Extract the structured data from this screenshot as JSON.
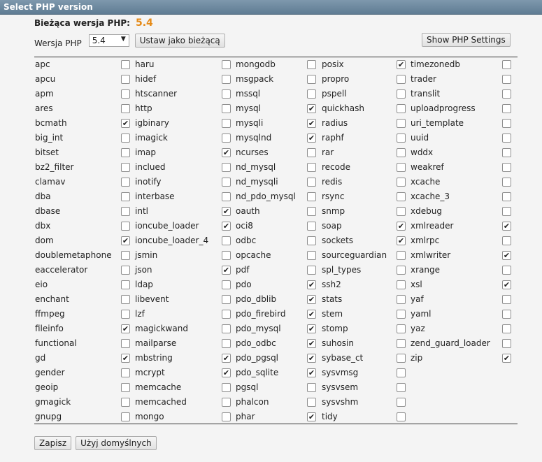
{
  "window": {
    "title": "Select PHP version"
  },
  "current": {
    "label": "Bieżąca wersja PHP:",
    "value": "5.4"
  },
  "version": {
    "label": "Wersja PHP",
    "selected": "5.4",
    "set_button": "Ustaw jako bieżącą",
    "settings_button": "Show PHP Settings"
  },
  "columns": [
    [
      {
        "name": "apc",
        "checked": false
      },
      {
        "name": "apcu",
        "checked": false
      },
      {
        "name": "apm",
        "checked": false
      },
      {
        "name": "ares",
        "checked": false
      },
      {
        "name": "bcmath",
        "checked": true
      },
      {
        "name": "big_int",
        "checked": false
      },
      {
        "name": "bitset",
        "checked": false
      },
      {
        "name": "bz2_filter",
        "checked": false
      },
      {
        "name": "clamav",
        "checked": false
      },
      {
        "name": "dba",
        "checked": false
      },
      {
        "name": "dbase",
        "checked": false
      },
      {
        "name": "dbx",
        "checked": false
      },
      {
        "name": "dom",
        "checked": true
      },
      {
        "name": "doublemetaphone",
        "checked": false
      },
      {
        "name": "eaccelerator",
        "checked": false
      },
      {
        "name": "eio",
        "checked": false
      },
      {
        "name": "enchant",
        "checked": false
      },
      {
        "name": "ffmpeg",
        "checked": false
      },
      {
        "name": "fileinfo",
        "checked": true
      },
      {
        "name": "functional",
        "checked": false
      },
      {
        "name": "gd",
        "checked": true
      },
      {
        "name": "gender",
        "checked": false
      },
      {
        "name": "geoip",
        "checked": false
      },
      {
        "name": "gmagick",
        "checked": false
      },
      {
        "name": "gnupg",
        "checked": false
      }
    ],
    [
      {
        "name": "haru",
        "checked": false
      },
      {
        "name": "hidef",
        "checked": false
      },
      {
        "name": "htscanner",
        "checked": false
      },
      {
        "name": "http",
        "checked": false
      },
      {
        "name": "igbinary",
        "checked": false
      },
      {
        "name": "imagick",
        "checked": false
      },
      {
        "name": "imap",
        "checked": true
      },
      {
        "name": "inclued",
        "checked": false
      },
      {
        "name": "inotify",
        "checked": false
      },
      {
        "name": "interbase",
        "checked": false
      },
      {
        "name": "intl",
        "checked": true
      },
      {
        "name": "ioncube_loader",
        "checked": true
      },
      {
        "name": "ioncube_loader_4",
        "checked": false
      },
      {
        "name": "jsmin",
        "checked": false
      },
      {
        "name": "json",
        "checked": true
      },
      {
        "name": "ldap",
        "checked": false
      },
      {
        "name": "libevent",
        "checked": false
      },
      {
        "name": "lzf",
        "checked": false
      },
      {
        "name": "magickwand",
        "checked": false
      },
      {
        "name": "mailparse",
        "checked": false
      },
      {
        "name": "mbstring",
        "checked": true
      },
      {
        "name": "mcrypt",
        "checked": true
      },
      {
        "name": "memcache",
        "checked": false
      },
      {
        "name": "memcached",
        "checked": false
      },
      {
        "name": "mongo",
        "checked": false
      }
    ],
    [
      {
        "name": "mongodb",
        "checked": false
      },
      {
        "name": "msgpack",
        "checked": false
      },
      {
        "name": "mssql",
        "checked": false
      },
      {
        "name": "mysql",
        "checked": true
      },
      {
        "name": "mysqli",
        "checked": true
      },
      {
        "name": "mysqlnd",
        "checked": true
      },
      {
        "name": "ncurses",
        "checked": false
      },
      {
        "name": "nd_mysql",
        "checked": false
      },
      {
        "name": "nd_mysqli",
        "checked": false
      },
      {
        "name": "nd_pdo_mysql",
        "checked": false
      },
      {
        "name": "oauth",
        "checked": false
      },
      {
        "name": "oci8",
        "checked": false
      },
      {
        "name": "odbc",
        "checked": false
      },
      {
        "name": "opcache",
        "checked": false
      },
      {
        "name": "pdf",
        "checked": false
      },
      {
        "name": "pdo",
        "checked": true
      },
      {
        "name": "pdo_dblib",
        "checked": true
      },
      {
        "name": "pdo_firebird",
        "checked": true
      },
      {
        "name": "pdo_mysql",
        "checked": true
      },
      {
        "name": "pdo_odbc",
        "checked": true
      },
      {
        "name": "pdo_pgsql",
        "checked": true
      },
      {
        "name": "pdo_sqlite",
        "checked": true
      },
      {
        "name": "pgsql",
        "checked": false
      },
      {
        "name": "phalcon",
        "checked": false
      },
      {
        "name": "phar",
        "checked": true
      }
    ],
    [
      {
        "name": "posix",
        "checked": true
      },
      {
        "name": "propro",
        "checked": false
      },
      {
        "name": "pspell",
        "checked": false
      },
      {
        "name": "quickhash",
        "checked": false
      },
      {
        "name": "radius",
        "checked": false
      },
      {
        "name": "raphf",
        "checked": false
      },
      {
        "name": "rar",
        "checked": false
      },
      {
        "name": "recode",
        "checked": false
      },
      {
        "name": "redis",
        "checked": false
      },
      {
        "name": "rsync",
        "checked": false
      },
      {
        "name": "snmp",
        "checked": false
      },
      {
        "name": "soap",
        "checked": true
      },
      {
        "name": "sockets",
        "checked": true
      },
      {
        "name": "sourceguardian",
        "checked": false
      },
      {
        "name": "spl_types",
        "checked": false
      },
      {
        "name": "ssh2",
        "checked": false
      },
      {
        "name": "stats",
        "checked": false
      },
      {
        "name": "stem",
        "checked": false
      },
      {
        "name": "stomp",
        "checked": false
      },
      {
        "name": "suhosin",
        "checked": false
      },
      {
        "name": "sybase_ct",
        "checked": false
      },
      {
        "name": "sysvmsg",
        "checked": false
      },
      {
        "name": "sysvsem",
        "checked": false
      },
      {
        "name": "sysvshm",
        "checked": false
      },
      {
        "name": "tidy",
        "checked": false
      }
    ],
    [
      {
        "name": "timezonedb",
        "checked": false
      },
      {
        "name": "trader",
        "checked": false
      },
      {
        "name": "translit",
        "checked": false
      },
      {
        "name": "uploadprogress",
        "checked": false
      },
      {
        "name": "uri_template",
        "checked": false
      },
      {
        "name": "uuid",
        "checked": false
      },
      {
        "name": "wddx",
        "checked": false
      },
      {
        "name": "weakref",
        "checked": false
      },
      {
        "name": "xcache",
        "checked": false
      },
      {
        "name": "xcache_3",
        "checked": false
      },
      {
        "name": "xdebug",
        "checked": false
      },
      {
        "name": "xmlreader",
        "checked": true
      },
      {
        "name": "xmlrpc",
        "checked": false
      },
      {
        "name": "xmlwriter",
        "checked": true
      },
      {
        "name": "xrange",
        "checked": false
      },
      {
        "name": "xsl",
        "checked": true
      },
      {
        "name": "yaf",
        "checked": false
      },
      {
        "name": "yaml",
        "checked": false
      },
      {
        "name": "yaz",
        "checked": false
      },
      {
        "name": "zend_guard_loader",
        "checked": false
      },
      {
        "name": "zip",
        "checked": true
      }
    ]
  ],
  "footer": {
    "save_label": "Zapisz",
    "defaults_label": "Użyj domyślnych"
  }
}
